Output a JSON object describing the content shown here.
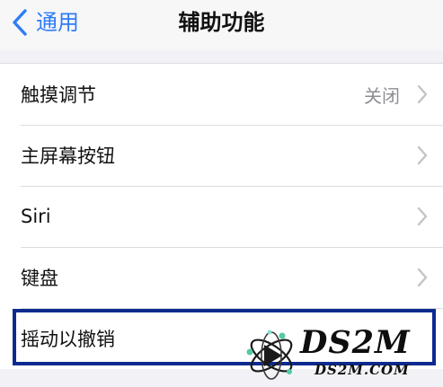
{
  "navbar": {
    "back_label": "通用",
    "title": "辅助功能"
  },
  "rows": [
    {
      "label": "触摸调节",
      "value": "关闭"
    },
    {
      "label": "主屏幕按钮",
      "value": ""
    },
    {
      "label": "Siri",
      "value": ""
    },
    {
      "label": "键盘",
      "value": ""
    },
    {
      "label": "摇动以撤销",
      "value": ""
    }
  ],
  "watermark": {
    "title": "DS2M",
    "url": "DS2M.COM"
  },
  "colors": {
    "accent": "#2f7cf6",
    "highlight_border": "#0d2a8f",
    "secondary_text": "#8e8e93"
  }
}
